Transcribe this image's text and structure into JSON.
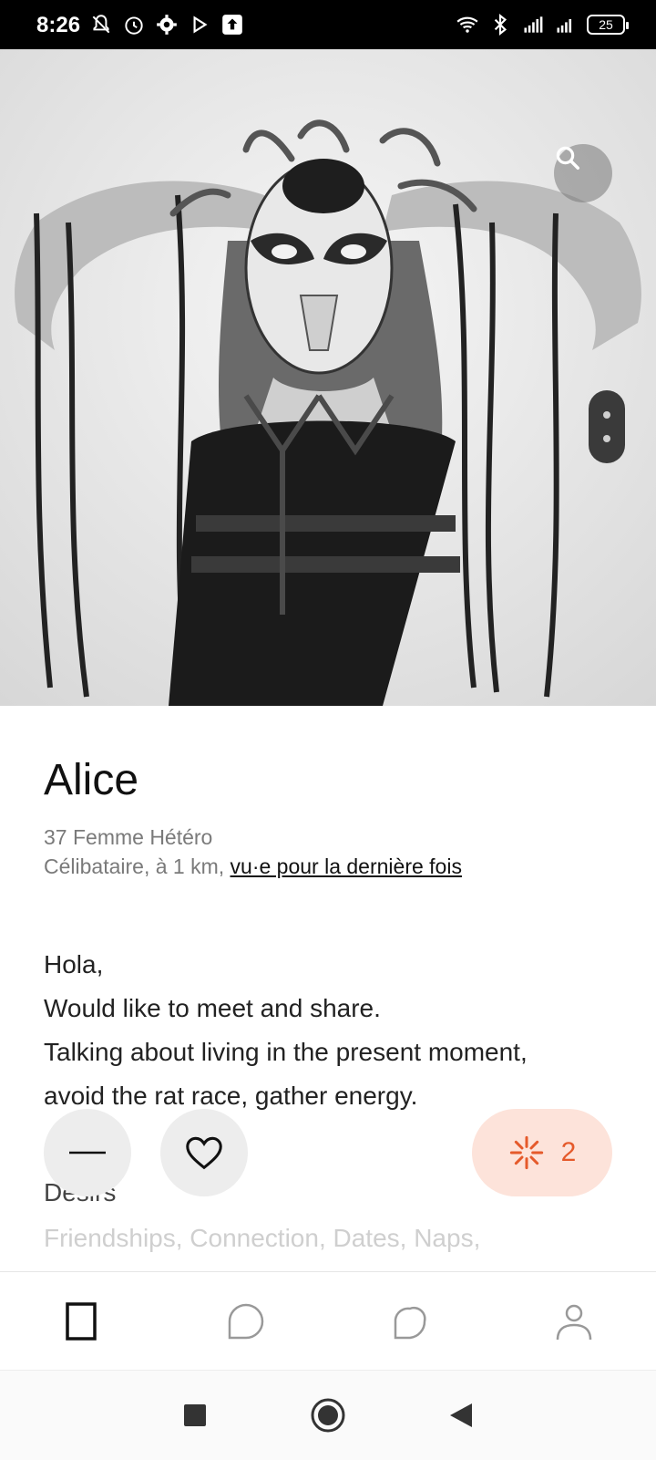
{
  "status_bar": {
    "time": "8:26",
    "battery": "25",
    "left_icons": [
      "mute-icon",
      "alarm-icon",
      "settings-icon",
      "play-icon",
      "upload-icon"
    ],
    "right_icons": [
      "wifi-icon",
      "bluetooth-icon",
      "signal-4g-icon",
      "signal-r-icon",
      "battery-icon"
    ]
  },
  "photo": {
    "icons": [
      "search-icon"
    ],
    "pager_dots": 2
  },
  "profile": {
    "name": "Alice",
    "meta_line1": "37 Femme Hétéro",
    "meta_line2_prefix": "Célibataire, à 1 km, ",
    "meta_line2_link": "vu·e pour la dernière fois",
    "bio": {
      "line1": "Hola,",
      "line2": "Would like to meet and share.",
      "line3": "Talking about living in the present moment,",
      "line4": "avoid the rat race, gather energy."
    },
    "desires_title": "Desirs",
    "desires_list": "Friendships, Connection, Dates, Naps,"
  },
  "actions": {
    "pass_icon": "minus-icon",
    "like_icon": "heart-icon",
    "spark_icon": "sparkle-icon",
    "spark_count": "2",
    "spark_color": "#e55a2b"
  },
  "bottom_nav": {
    "items": [
      "home-icon",
      "chat-icon",
      "likes-icon",
      "profile-icon"
    ]
  },
  "system_nav": {
    "items": [
      "recent-apps-icon",
      "home-button-icon",
      "back-icon"
    ]
  }
}
